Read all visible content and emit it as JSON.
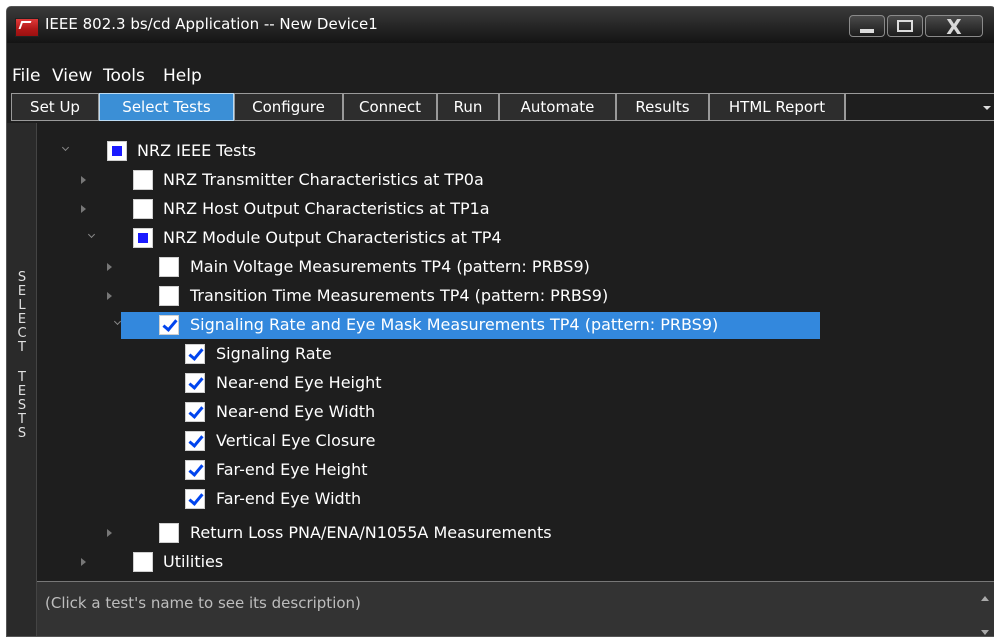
{
  "window": {
    "title": "IEEE 802.3 bs/cd Application -- New Device1",
    "controls": {
      "minimize": "minimize",
      "maximize": "maximize",
      "close": "X"
    }
  },
  "menu": [
    "File",
    "View",
    "Tools",
    "Help"
  ],
  "tabs": [
    "Set Up",
    "Select Tests",
    "Configure",
    "Connect",
    "Run",
    "Automate",
    "Results",
    "HTML Report"
  ],
  "active_tab": "Select Tests",
  "side_label": "SELECT TESTS",
  "tree": {
    "root": "NRZ IEEE Tests",
    "transmitter": "NRZ Transmitter Characteristics at TP0a",
    "host_output": "NRZ Host Output Characteristics at TP1a",
    "module_output": "NRZ Module Output Characteristics at TP4",
    "main_voltage": "Main Voltage Measurements TP4 (pattern: PRBS9)",
    "transition_time": "Transition Time Measurements TP4 (pattern: PRBS9)",
    "signaling_group": "Signaling Rate and Eye Mask Measurements TP4 (pattern: PRBS9)",
    "signaling_rate": "Signaling Rate",
    "near_eye_height": "Near-end Eye Height",
    "near_eye_width": "Near-end Eye Width",
    "vertical_eye_closure": "Vertical Eye Closure",
    "far_eye_height": "Far-end Eye Height",
    "far_eye_width": "Far-end Eye Width",
    "return_loss": "Return Loss PNA/ENA/N1055A Measurements",
    "utilities": "Utilities"
  },
  "description": "(Click a test's name to see its description)",
  "colors": {
    "background": "#1e1e1e",
    "selection": "#3388dd",
    "active_tab": "#3b8fd6",
    "partial_check": "#1a1aff",
    "check": "#0044ee"
  }
}
